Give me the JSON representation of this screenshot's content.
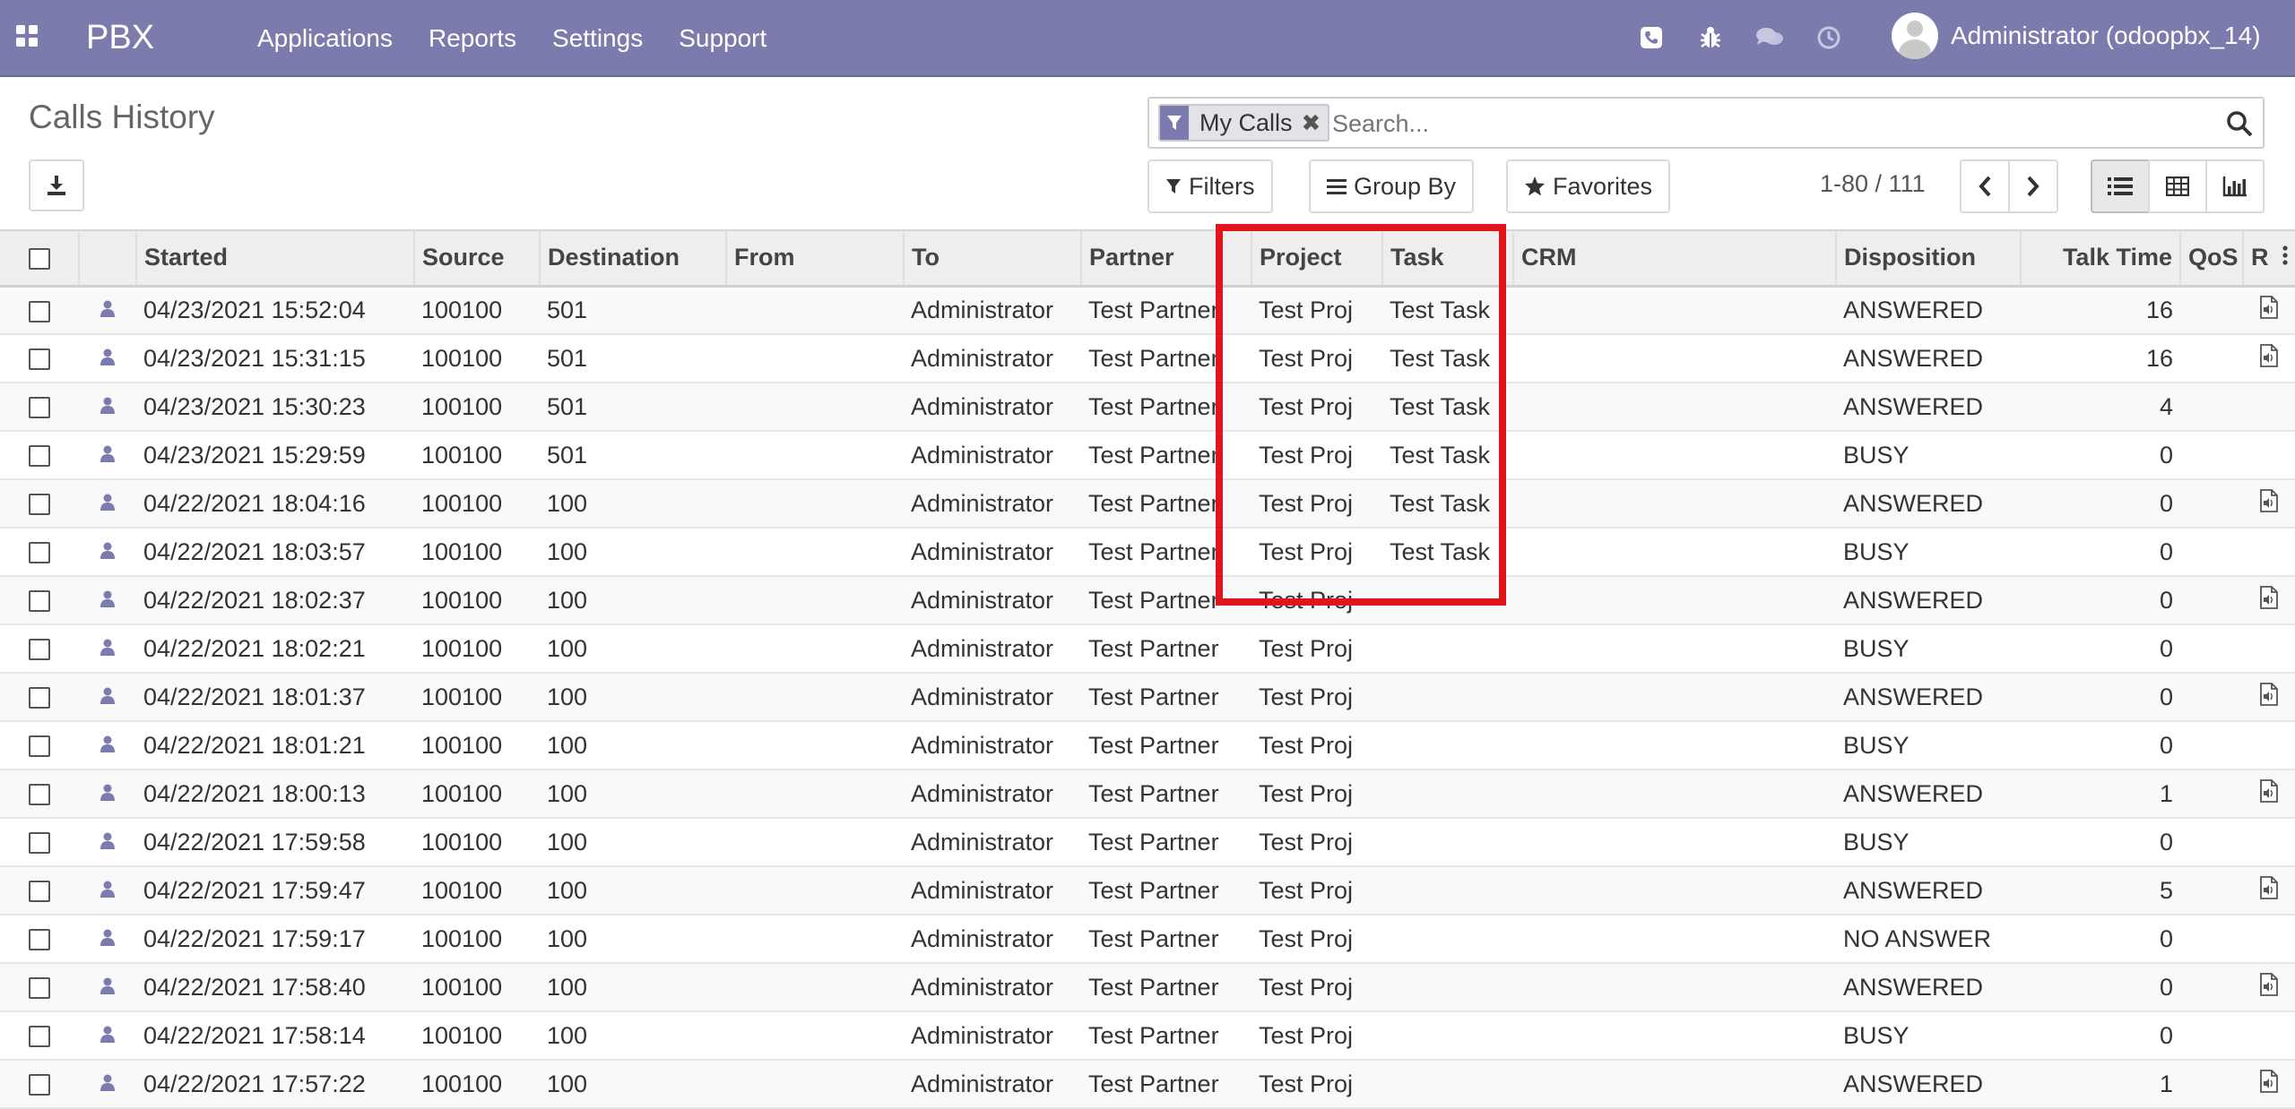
{
  "navbar": {
    "brand": "PBX",
    "menu": [
      "Applications",
      "Reports",
      "Settings",
      "Support"
    ],
    "user": "Administrator (odoopbx_14)",
    "color": "#7c7bad"
  },
  "control": {
    "title": "Calls History",
    "facet_label": "My Calls",
    "search_placeholder": "Search...",
    "filters_label": "Filters",
    "groupby_label": "Group By",
    "favorites_label": "Favorites",
    "pager": "1-80 / 111"
  },
  "table": {
    "columns": [
      "Started",
      "Source",
      "Destination",
      "From",
      "To",
      "Partner",
      "Project",
      "Task",
      "CRM",
      "Disposition",
      "Talk Time",
      "QoS",
      "R"
    ],
    "rows": [
      {
        "started": "04/23/2021 15:52:04",
        "source": "100100",
        "destination": "501",
        "from": "",
        "to": "Administrator",
        "partner": "Test Partner",
        "project": "Test Proj",
        "task": "Test Task",
        "crm": "",
        "disposition": "ANSWERED",
        "talk": "16",
        "rec": true
      },
      {
        "started": "04/23/2021 15:31:15",
        "source": "100100",
        "destination": "501",
        "from": "",
        "to": "Administrator",
        "partner": "Test Partner",
        "project": "Test Proj",
        "task": "Test Task",
        "crm": "",
        "disposition": "ANSWERED",
        "talk": "16",
        "rec": true
      },
      {
        "started": "04/23/2021 15:30:23",
        "source": "100100",
        "destination": "501",
        "from": "",
        "to": "Administrator",
        "partner": "Test Partner",
        "project": "Test Proj",
        "task": "Test Task",
        "crm": "",
        "disposition": "ANSWERED",
        "talk": "4",
        "rec": false
      },
      {
        "started": "04/23/2021 15:29:59",
        "source": "100100",
        "destination": "501",
        "from": "",
        "to": "Administrator",
        "partner": "Test Partner",
        "project": "Test Proj",
        "task": "Test Task",
        "crm": "",
        "disposition": "BUSY",
        "talk": "0",
        "rec": false
      },
      {
        "started": "04/22/2021 18:04:16",
        "source": "100100",
        "destination": "100",
        "from": "",
        "to": "Administrator",
        "partner": "Test Partner",
        "project": "Test Proj",
        "task": "Test Task",
        "crm": "",
        "disposition": "ANSWERED",
        "talk": "0",
        "rec": true
      },
      {
        "started": "04/22/2021 18:03:57",
        "source": "100100",
        "destination": "100",
        "from": "",
        "to": "Administrator",
        "partner": "Test Partner",
        "project": "Test Proj",
        "task": "Test Task",
        "crm": "",
        "disposition": "BUSY",
        "talk": "0",
        "rec": false
      },
      {
        "started": "04/22/2021 18:02:37",
        "source": "100100",
        "destination": "100",
        "from": "",
        "to": "Administrator",
        "partner": "Test Partner",
        "project": "Test Proj",
        "task": "",
        "crm": "",
        "disposition": "ANSWERED",
        "talk": "0",
        "rec": true
      },
      {
        "started": "04/22/2021 18:02:21",
        "source": "100100",
        "destination": "100",
        "from": "",
        "to": "Administrator",
        "partner": "Test Partner",
        "project": "Test Proj",
        "task": "",
        "crm": "",
        "disposition": "BUSY",
        "talk": "0",
        "rec": false
      },
      {
        "started": "04/22/2021 18:01:37",
        "source": "100100",
        "destination": "100",
        "from": "",
        "to": "Administrator",
        "partner": "Test Partner",
        "project": "Test Proj",
        "task": "",
        "crm": "",
        "disposition": "ANSWERED",
        "talk": "0",
        "rec": true
      },
      {
        "started": "04/22/2021 18:01:21",
        "source": "100100",
        "destination": "100",
        "from": "",
        "to": "Administrator",
        "partner": "Test Partner",
        "project": "Test Proj",
        "task": "",
        "crm": "",
        "disposition": "BUSY",
        "talk": "0",
        "rec": false
      },
      {
        "started": "04/22/2021 18:00:13",
        "source": "100100",
        "destination": "100",
        "from": "",
        "to": "Administrator",
        "partner": "Test Partner",
        "project": "Test Proj",
        "task": "",
        "crm": "",
        "disposition": "ANSWERED",
        "talk": "1",
        "rec": true
      },
      {
        "started": "04/22/2021 17:59:58",
        "source": "100100",
        "destination": "100",
        "from": "",
        "to": "Administrator",
        "partner": "Test Partner",
        "project": "Test Proj",
        "task": "",
        "crm": "",
        "disposition": "BUSY",
        "talk": "0",
        "rec": false
      },
      {
        "started": "04/22/2021 17:59:47",
        "source": "100100",
        "destination": "100",
        "from": "",
        "to": "Administrator",
        "partner": "Test Partner",
        "project": "Test Proj",
        "task": "",
        "crm": "",
        "disposition": "ANSWERED",
        "talk": "5",
        "rec": true
      },
      {
        "started": "04/22/2021 17:59:17",
        "source": "100100",
        "destination": "100",
        "from": "",
        "to": "Administrator",
        "partner": "Test Partner",
        "project": "Test Proj",
        "task": "",
        "crm": "",
        "disposition": "NO ANSWER",
        "talk": "0",
        "rec": false
      },
      {
        "started": "04/22/2021 17:58:40",
        "source": "100100",
        "destination": "100",
        "from": "",
        "to": "Administrator",
        "partner": "Test Partner",
        "project": "Test Proj",
        "task": "",
        "crm": "",
        "disposition": "ANSWERED",
        "talk": "0",
        "rec": true
      },
      {
        "started": "04/22/2021 17:58:14",
        "source": "100100",
        "destination": "100",
        "from": "",
        "to": "Administrator",
        "partner": "Test Partner",
        "project": "Test Proj",
        "task": "",
        "crm": "",
        "disposition": "BUSY",
        "talk": "0",
        "rec": false
      },
      {
        "started": "04/22/2021 17:57:22",
        "source": "100100",
        "destination": "100",
        "from": "",
        "to": "Administrator",
        "partner": "Test Partner",
        "project": "Test Proj",
        "task": "",
        "crm": "",
        "disposition": "ANSWERED",
        "talk": "1",
        "rec": true
      }
    ]
  },
  "icons": {
    "apps": "apps-grid-icon",
    "phone": "phone-icon",
    "debug": "bug-icon",
    "messages": "chat-icon",
    "activities": "clock-icon",
    "download": "download-icon",
    "search": "search-icon",
    "caller": "user-icon",
    "recording": "audio-file-icon"
  },
  "highlight_color": "#e1141c"
}
